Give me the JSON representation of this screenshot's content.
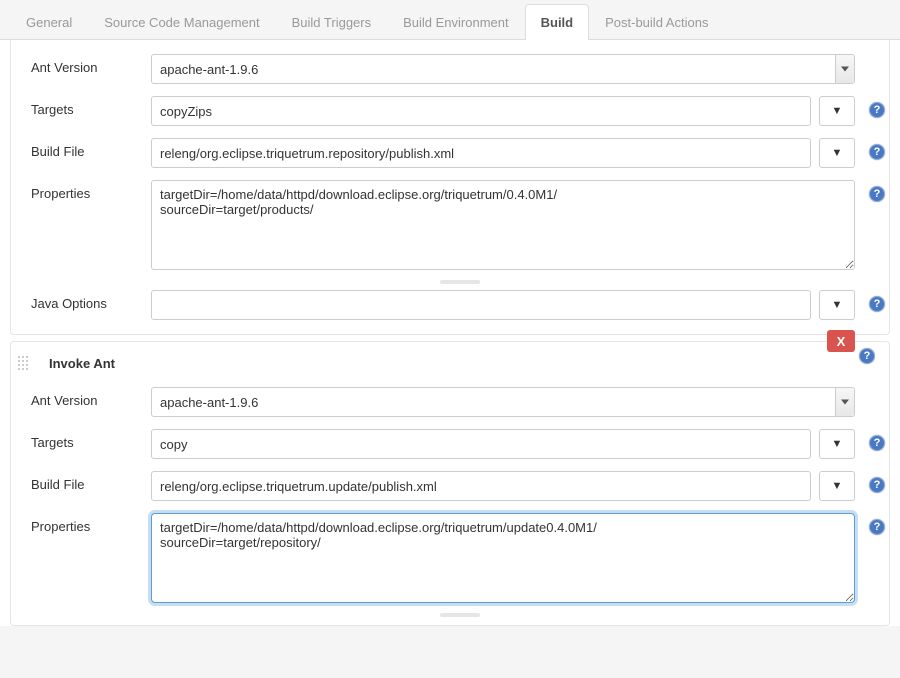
{
  "tabs": [
    {
      "label": "General"
    },
    {
      "label": "Source Code Management"
    },
    {
      "label": "Build Triggers"
    },
    {
      "label": "Build Environment"
    },
    {
      "label": "Build",
      "active": true
    },
    {
      "label": "Post-build Actions"
    }
  ],
  "sections": [
    {
      "antVersionLabel": "Ant Version",
      "antVersion": "apache-ant-1.9.6",
      "targetsLabel": "Targets",
      "targets": "copyZips",
      "buildFileLabel": "Build File",
      "buildFile": "releng/org.eclipse.triquetrum.repository/publish.xml",
      "propertiesLabel": "Properties",
      "properties": "targetDir=/home/data/httpd/download.eclipse.org/triquetrum/0.4.0M1/\nsourceDir=target/products/",
      "javaOptionsLabel": "Java Options",
      "javaOptions": ""
    },
    {
      "title": "Invoke Ant",
      "deleteLabel": "X",
      "antVersionLabel": "Ant Version",
      "antVersion": "apache-ant-1.9.6",
      "targetsLabel": "Targets",
      "targets": "copy",
      "buildFileLabel": "Build File",
      "buildFile": "releng/org.eclipse.triquetrum.update/publish.xml",
      "propertiesLabel": "Properties",
      "properties": "targetDir=/home/data/httpd/download.eclipse.org/triquetrum/update0.4.0M1/\nsourceDir=target/repository/"
    }
  ],
  "icons": {
    "help": "?",
    "dropdown": "▼"
  }
}
